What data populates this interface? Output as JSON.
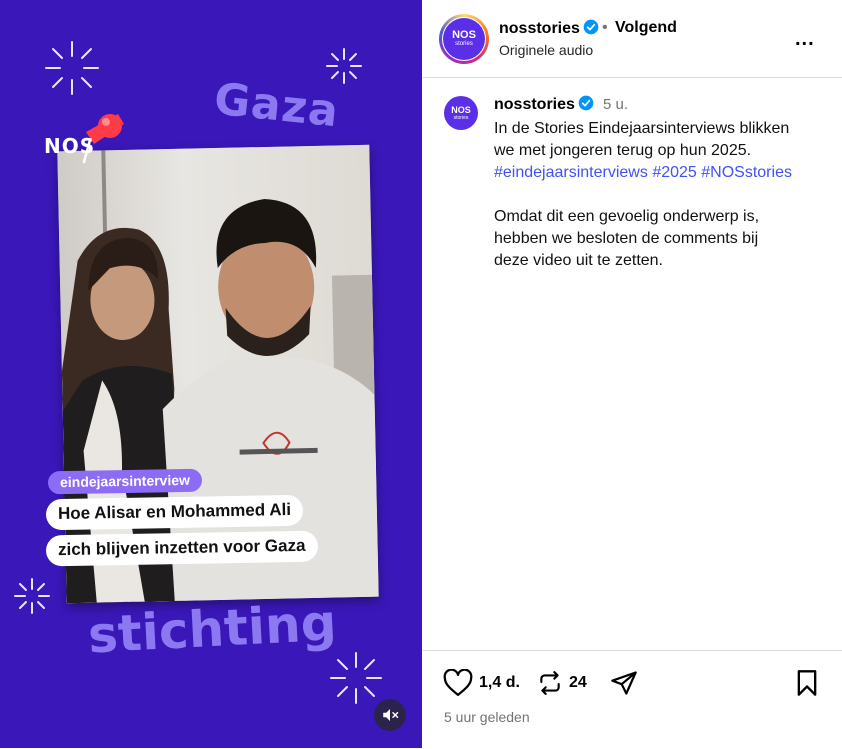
{
  "media": {
    "word_top": "Gaza",
    "word_bottom": "stichting",
    "brand_logo": "NOS",
    "tag": "eindejaarsinterview",
    "subtitle_line1": "Hoe Alisar en Mohammed Ali",
    "subtitle_line2": "zich blijven inzetten voor Gaza",
    "mute_icon": "speaker-muted-icon"
  },
  "header": {
    "avatar_text": "NOS",
    "avatar_sub": "stories",
    "username": "nosstories",
    "follow_label": "Volgend",
    "audio_label": "Originele audio",
    "more_label": "..."
  },
  "caption": {
    "username": "nosstories",
    "time": "5 u.",
    "line1": "In de Stories Eindejaarsinterviews blikken",
    "line2": "we met jongeren terug op hun 2025.",
    "hashtag1": "#eindejaarsinterviews",
    "hashtag2": "#2025",
    "hashtag3": "#NOSstories",
    "para2_line1": "Omdat dit een gevoelig onderwerp is,",
    "para2_line2": "hebben we besloten de comments bij",
    "para2_line3": "deze video uit te zetten."
  },
  "actions": {
    "likes": "1,4 d.",
    "reposts": "24",
    "timestamp": "5 uur geleden"
  },
  "colors": {
    "media_bg": "#3a17b8",
    "accent_text": "#8c79f1",
    "hashtag": "#4150f7",
    "verified": "#0095f6"
  }
}
